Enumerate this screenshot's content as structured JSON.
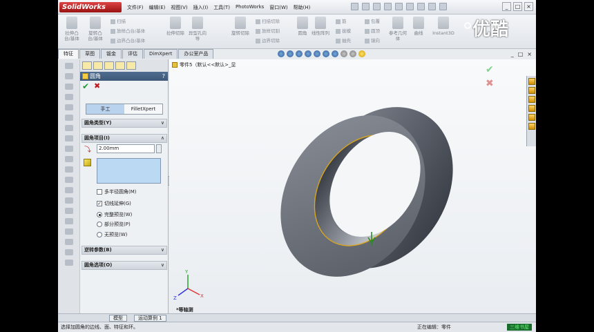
{
  "titlebar": {
    "logo": "SolidWorks",
    "menu": [
      "文件(F)",
      "编辑(E)",
      "视图(V)",
      "插入(I)",
      "工具(T)",
      "PhotoWorks",
      "窗口(W)",
      "帮助(H)"
    ],
    "window_controls": [
      "_",
      "□",
      "×"
    ]
  },
  "ribbon": {
    "buttons": [
      {
        "label": "拉伸凸台/基体"
      },
      {
        "label": "旋转凸台/基体"
      },
      {
        "label": "拉伸切除"
      },
      {
        "label": "异型孔向导"
      },
      {
        "label": "旋转切除"
      },
      {
        "label": "圆角"
      },
      {
        "label": "线性阵列"
      },
      {
        "label": "参考几何体"
      },
      {
        "label": "曲线"
      },
      {
        "label": "Instant3D"
      }
    ],
    "small": [
      "扫描",
      "放样凸台/基体",
      "边界凸台/基体",
      "扫描切除",
      "放样切割",
      "边界切除",
      "筋",
      "拔模",
      "抽壳",
      "包覆",
      "圆顶",
      "镜向"
    ]
  },
  "tabs": [
    "特征",
    "草图",
    "钣金",
    "评估",
    "DimXpert",
    "办公室产品"
  ],
  "doc_controls": [
    "_",
    "□",
    "×"
  ],
  "property_manager": {
    "title": "圆角",
    "help": "?",
    "ok": "✔",
    "cancel": "✖",
    "modes": [
      "手工",
      "FilletXpert"
    ],
    "sections": {
      "type": "圆角类型(Y)",
      "items": "圆角项目(I)",
      "params": "逆转参数(B)",
      "options": "圆角选项(O)"
    },
    "radius_value": "2.00mm",
    "options": {
      "multi_radius": "多半径圆角(M)",
      "tangent": "切线延伸(G)",
      "full_preview": "完整预览(W)",
      "partial_preview": "部分预览(P)",
      "no_preview": "无预览(W)"
    },
    "collapse_symbol": "»"
  },
  "viewport": {
    "tree_label": "零件5（默认<<默认>_显",
    "view_name": "*等轴测",
    "axes": {
      "x": "X",
      "y": "Y",
      "z": "Z"
    },
    "confirm_ok": "✔",
    "confirm_cancel": "✖"
  },
  "bottom_tabs": [
    "模型",
    "运动算例 1"
  ],
  "status": {
    "left": "选择加圆角的边线、面、特征和环。",
    "right": "正在编辑：零件",
    "badge": "三维书屋"
  },
  "watermark": "优酷",
  "colors": {
    "accent": "#3e5878",
    "ok": "#1a9a2a",
    "cancel": "#c21b1b",
    "selection": "#bcd9f3"
  }
}
